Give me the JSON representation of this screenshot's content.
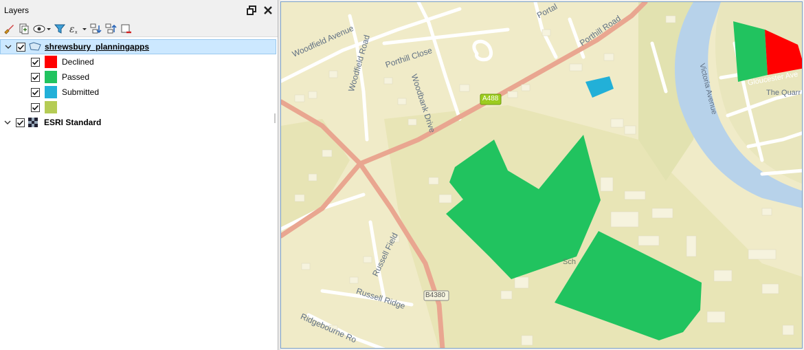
{
  "panel": {
    "title": "Layers",
    "float_icon": "float-panel-icon",
    "close_icon": "close-icon",
    "toolbar": [
      "style-brush-icon",
      "add-group-icon",
      "visibility-eye-icon",
      "filter-funnel-icon",
      "expression-filter-icon",
      "expand-all-icon",
      "collapse-all-icon",
      "remove-layer-icon"
    ]
  },
  "layers": [
    {
      "name": "shrewsbury_planningapps",
      "checked": true,
      "expanded": true,
      "icon": "polygon-layer-icon",
      "legend": [
        {
          "label": "Declined",
          "color": "#ff0000",
          "checked": true
        },
        {
          "label": "Passed",
          "color": "#21c35f",
          "checked": true
        },
        {
          "label": "Submitted",
          "color": "#22b0d8",
          "checked": true
        },
        {
          "label": "",
          "color": "#b5cc55",
          "checked": true
        }
      ]
    },
    {
      "name": "ESRI Standard",
      "checked": true,
      "expanded": true,
      "icon": "raster-tile-layer-icon"
    }
  ],
  "map": {
    "road_labels": [
      "Woodfield Avenue",
      "Woodfield Road",
      "Porthill Close",
      "Portal",
      "Porthill Road",
      "Woodbank Drive",
      "A488",
      "Russell Field",
      "Russell Ridge",
      "B4380",
      "Ridgebourne Ro",
      "Victoria Avenue",
      "Gloucester Ave",
      "The Quarr",
      "Sch"
    ],
    "colors": {
      "background": "#f0ebc8",
      "field": "#e7e6b8",
      "major_road": "#e9a690",
      "minor_road": "#ffffff",
      "river": "#b7d2ea",
      "building": "#f5f3dd"
    }
  }
}
